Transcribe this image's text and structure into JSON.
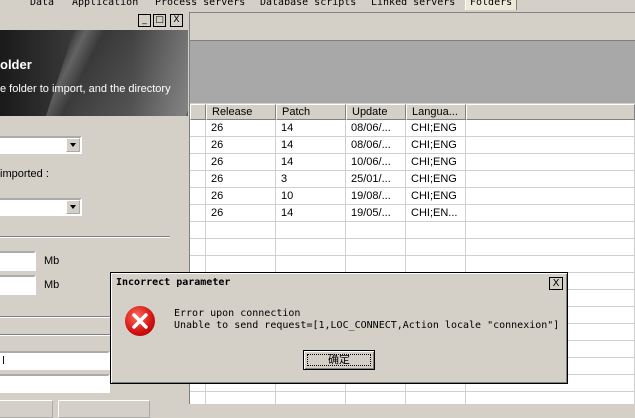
{
  "tabs": [
    "Data",
    "Application",
    "Process servers",
    "Database scripts",
    "Linked servers",
    "Folders"
  ],
  "active_tab": "Folders",
  "subwindow": {
    "controls": {
      "minimize": "_",
      "maximize": "□",
      "close": "X"
    },
    "banner_title": "older",
    "banner_subtitle": "e folder to import, and the directory",
    "label_imported": "imported :",
    "unit_1": "Mb",
    "unit_2": "Mb",
    "field_value": "l"
  },
  "grid": {
    "columns": [
      "Release",
      "Patch",
      "Update",
      "Langua..."
    ],
    "rows": [
      [
        "26",
        "14",
        "08/06/...",
        "CHI;ENG"
      ],
      [
        "26",
        "14",
        "08/06/...",
        "CHI;ENG"
      ],
      [
        "26",
        "14",
        "10/06/...",
        "CHI;ENG"
      ],
      [
        "26",
        "3",
        "25/01/...",
        "CHI;ENG"
      ],
      [
        "26",
        "10",
        "19/08/...",
        "CHI;ENG"
      ],
      [
        "26",
        "14",
        "19/05/...",
        "CHI;EN..."
      ]
    ]
  },
  "dialog": {
    "title": "Incorrect parameter",
    "close": "X",
    "line1": "Error upon connection",
    "line2": "Unable to send request=[1,LOC_CONNECT,Action locale \"connexion\"]",
    "ok_label": "确定",
    "icon": "error-icon",
    "icon_color": "#d01010"
  }
}
